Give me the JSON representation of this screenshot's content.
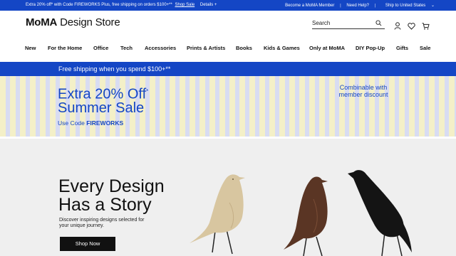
{
  "topbar": {
    "promo_text": "Extra 20% off* with Code FIREWORKS Plus, free shipping on orders $100+**",
    "shop_sale": "Shop Sale",
    "details": "Details",
    "details_icon": "plus-icon",
    "member": "Become a MoMA Member",
    "help": "Need Help?",
    "ship_to": "Ship to United States",
    "ship_icon": "chevron-down-icon"
  },
  "header": {
    "logo_bold": "MoMA",
    "logo_rest": "Design Store",
    "search_placeholder": "Search",
    "icons": [
      "search-icon",
      "user-icon",
      "heart-icon",
      "cart-icon"
    ]
  },
  "nav": {
    "items": [
      "New",
      "For the Home",
      "Office",
      "Tech",
      "Accessories",
      "Prints & Artists",
      "Books",
      "Kids & Games",
      "Only at MoMA",
      "DIY Pop-Up",
      "Gifts",
      "Sale"
    ]
  },
  "shipping_banner": {
    "text": "Free shipping when you spend $100+**"
  },
  "sale_banner": {
    "title_line1": "Extra 20% Off",
    "title_sup": "*",
    "title_line2": "Summer Sale",
    "code_prefix": "Use Code",
    "code": "FIREWORKS",
    "combinable_line1": "Combinable with",
    "combinable_line2": "member discount"
  },
  "hero": {
    "heading_line1": "Every Design",
    "heading_line2": "Has a Story",
    "subtext": "Discover inspiring designs selected for your unique journey.",
    "button": "Shop Now"
  },
  "colors": {
    "brand_blue": "#1446c5",
    "stripe_yellow": "#f4f0c8",
    "stripe_lavender": "#d8dcf2",
    "hero_bg": "#efefef"
  }
}
